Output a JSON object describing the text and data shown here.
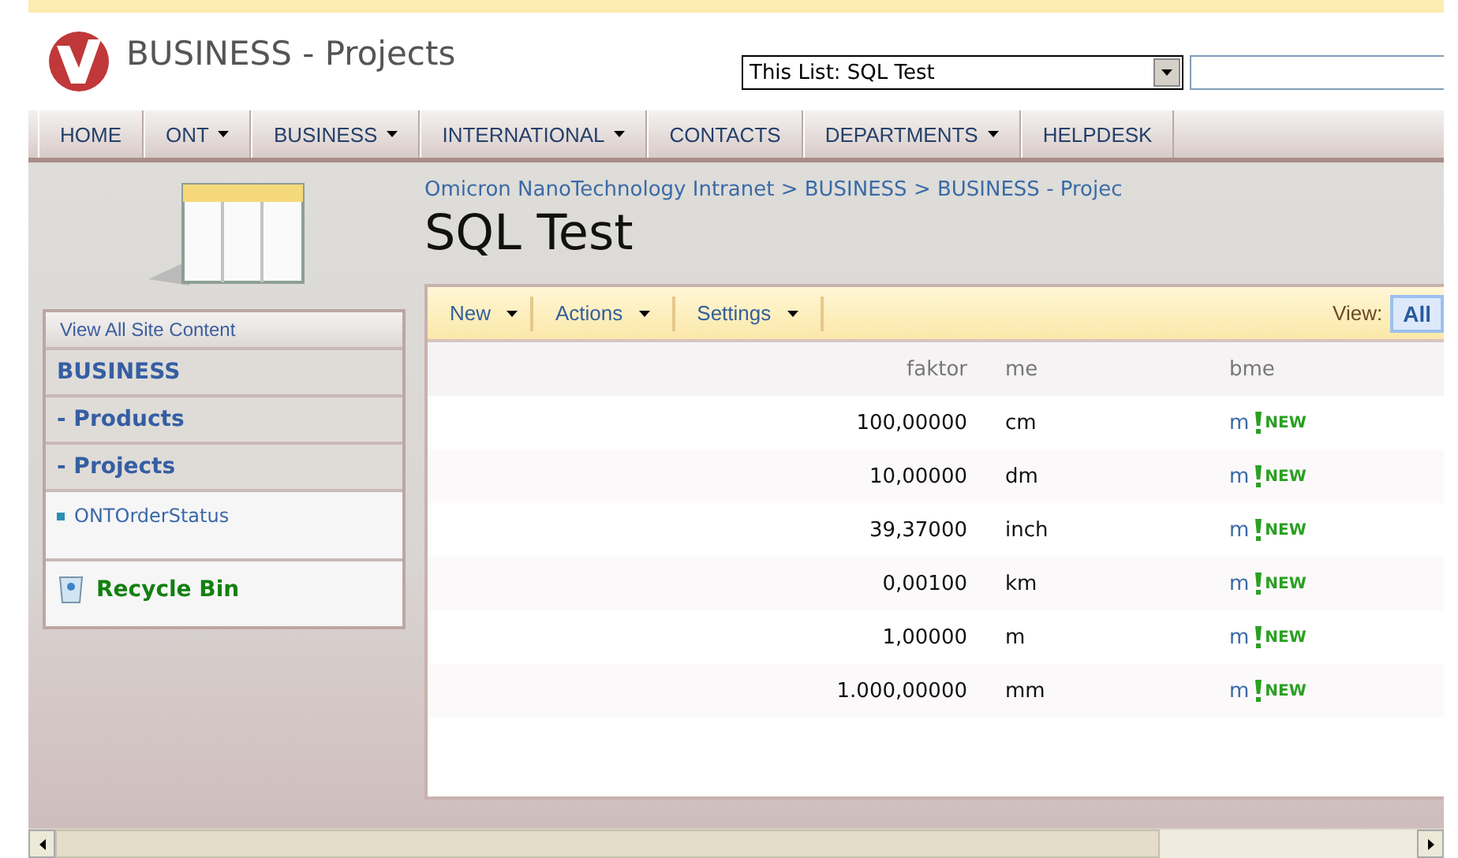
{
  "header": {
    "site_title": "BUSINESS - Projects",
    "search_scope": "This List: SQL Test"
  },
  "nav": [
    {
      "label": "HOME",
      "dropdown": false
    },
    {
      "label": "ONT",
      "dropdown": true
    },
    {
      "label": "BUSINESS",
      "dropdown": true
    },
    {
      "label": "INTERNATIONAL",
      "dropdown": true
    },
    {
      "label": "CONTACTS",
      "dropdown": false
    },
    {
      "label": "DEPARTMENTS",
      "dropdown": true
    },
    {
      "label": "HELPDESK",
      "dropdown": false
    }
  ],
  "breadcrumb": "Omicron NanoTechnology Intranet > BUSINESS > BUSINESS - Projec",
  "page_title": "SQL Test",
  "sidebar": {
    "view_all": "View All Site Content",
    "items": [
      {
        "label": "BUSINESS",
        "kind": "heading"
      },
      {
        "label": "- Products",
        "kind": "heading"
      },
      {
        "label": "- Projects",
        "kind": "heading"
      },
      {
        "label": "ONTOrderStatus",
        "kind": "link"
      }
    ],
    "recycle_bin": "Recycle Bin"
  },
  "toolbar": {
    "menus": [
      {
        "label": "New"
      },
      {
        "label": "Actions"
      },
      {
        "label": "Settings"
      }
    ],
    "view_label": "View:",
    "view_value": "All"
  },
  "table": {
    "columns": [
      "faktor",
      "me",
      "bme"
    ],
    "rows": [
      {
        "faktor": "100,00000",
        "me": "cm",
        "bme": "m",
        "new_badge": "NEW"
      },
      {
        "faktor": "10,00000",
        "me": "dm",
        "bme": "m",
        "new_badge": "NEW"
      },
      {
        "faktor": "39,37000",
        "me": "inch",
        "bme": "m",
        "new_badge": "NEW"
      },
      {
        "faktor": "0,00100",
        "me": "km",
        "bme": "m",
        "new_badge": "NEW"
      },
      {
        "faktor": "1,00000",
        "me": "m",
        "bme": "m",
        "new_badge": "NEW"
      },
      {
        "faktor": "1.000,00000",
        "me": "mm",
        "bme": "m",
        "new_badge": "NEW"
      }
    ]
  }
}
